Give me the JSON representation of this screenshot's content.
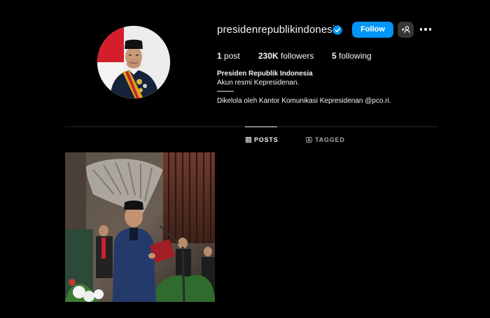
{
  "profile": {
    "username": "presidenrepublikindonesia",
    "verified": true,
    "follow_label": "Follow",
    "suggest_icon": "add-person-icon",
    "more_icon": "more-options-icon",
    "stats": {
      "posts_count": "1",
      "posts_label": "post",
      "followers_count": "230K",
      "followers_label": "followers",
      "following_count": "5",
      "following_label": "following"
    },
    "full_name": "Presiden Republik Indonesia",
    "bio_line1": "Akun resmi Kepresidenan.",
    "bio_line2": "Dikelola oleh Kantor Komunikasi Kepresidenan @pco.ri."
  },
  "tabs": [
    {
      "label": "POSTS",
      "icon": "grid-icon",
      "active": true
    },
    {
      "label": "TAGGED",
      "icon": "tag-person-icon",
      "active": false
    }
  ],
  "colors": {
    "background": "#000000",
    "follow_button": "#0095f6",
    "secondary_button": "#363636",
    "verified_badge": "#0095f6",
    "inactive_tab": "#a8a8a8"
  }
}
